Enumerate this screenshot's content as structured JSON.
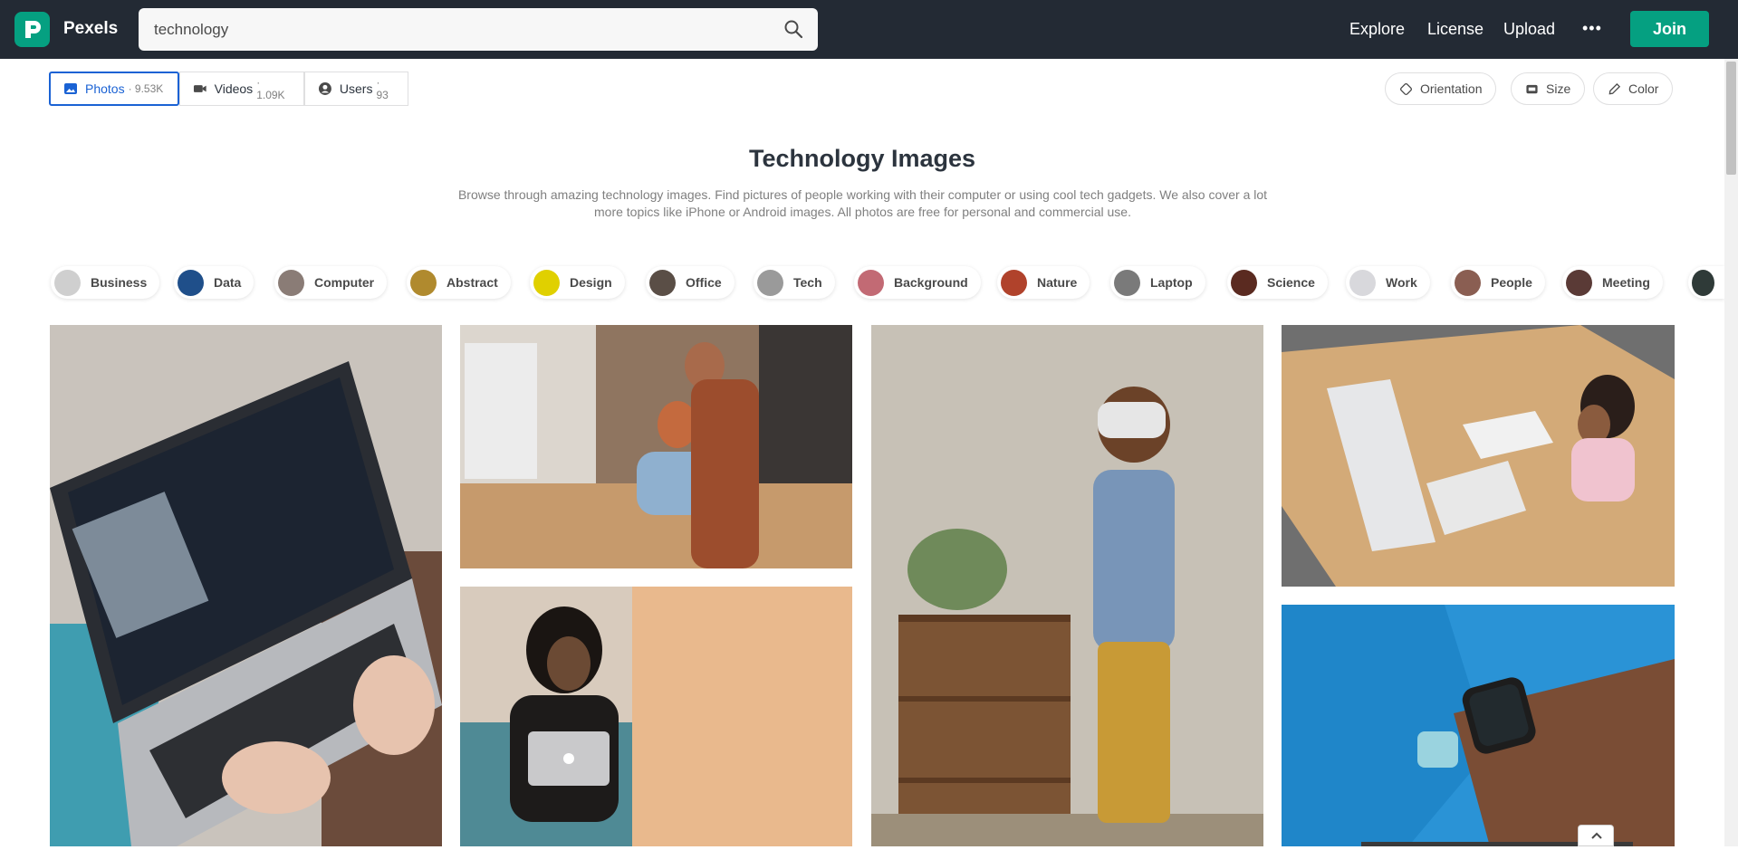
{
  "brand": {
    "name": "Pexels",
    "accent": "#05a081"
  },
  "search": {
    "value": "technology",
    "icon": "search-icon"
  },
  "nav": {
    "explore": "Explore",
    "license": "License",
    "upload": "Upload",
    "more": "•••",
    "join": "Join"
  },
  "tabs": [
    {
      "label": "Photos",
      "count": "· 9.53K",
      "icon": "photo-icon",
      "active": true
    },
    {
      "label": "Videos",
      "count": "· 1.09K",
      "icon": "video-icon",
      "active": false
    },
    {
      "label": "Users",
      "count": "· 93",
      "icon": "user-icon",
      "active": false
    }
  ],
  "filters": [
    {
      "label": "Orientation",
      "icon": "orientation-icon"
    },
    {
      "label": "Size",
      "icon": "size-icon"
    },
    {
      "label": "Color",
      "icon": "color-picker-icon"
    }
  ],
  "page": {
    "title": "Technology Images",
    "description": "Browse through amazing technology images. Find pictures of people working with their computer or using cool tech gadgets. We also cover a lot more topics like iPhone or Android images. All photos are free for personal and commercial use."
  },
  "chips": [
    {
      "label": "Business",
      "color": "#cfcfcf"
    },
    {
      "label": "Data",
      "color": "#1f4f8a"
    },
    {
      "label": "Computer",
      "color": "#8a7c76"
    },
    {
      "label": "Abstract",
      "color": "#b08a2e"
    },
    {
      "label": "Design",
      "color": "#e0d000"
    },
    {
      "label": "Office",
      "color": "#5a4e46"
    },
    {
      "label": "Tech",
      "color": "#9a9a9a"
    },
    {
      "label": "Background",
      "color": "#c26a74"
    },
    {
      "label": "Nature",
      "color": "#b0422b"
    },
    {
      "label": "Laptop",
      "color": "#7a7a7a"
    },
    {
      "label": "Science",
      "color": "#5a2a20"
    },
    {
      "label": "Work",
      "color": "#d8d8dc"
    },
    {
      "label": "People",
      "color": "#8a5e52"
    },
    {
      "label": "Meeting",
      "color": "#5a3a36"
    },
    {
      "label": "",
      "color": "#2f3a38"
    }
  ],
  "photos": [
    {
      "name": "photo-laptop-video-call",
      "color": "#6f7c86"
    },
    {
      "name": "photo-mother-son-computer",
      "color": "#b48a64"
    },
    {
      "name": "photo-woman-macbook",
      "color": "#e8b07c"
    },
    {
      "name": "photo-boy-vr-headset",
      "color": "#b7ad9d"
    },
    {
      "name": "photo-girl-desk-imac",
      "color": "#c7a47a"
    },
    {
      "name": "photo-smartwatch-wrist",
      "color": "#2a93d6"
    }
  ]
}
